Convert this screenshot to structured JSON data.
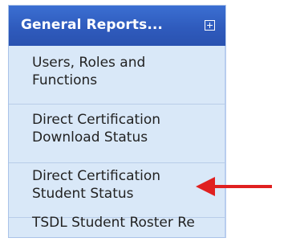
{
  "menu": {
    "title": "General Reports...",
    "items": [
      {
        "label": "Users, Roles and\nFunctions"
      },
      {
        "label": "Direct Certification\nDownload Status"
      },
      {
        "label": "Direct Certification\nStudent Status"
      },
      {
        "label": "TSDL Student Roster Re"
      }
    ]
  },
  "annotation": {
    "arrow_color": "#e02020",
    "points_to": "Direct Certification Student Status"
  }
}
